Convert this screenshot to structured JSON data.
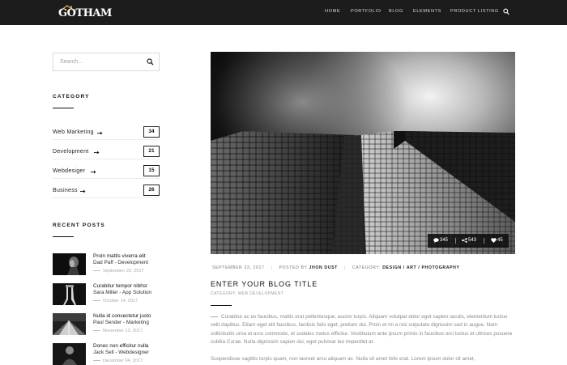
{
  "header": {
    "logo_text": "GOTHAM",
    "nav": [
      {
        "label": "HOME"
      },
      {
        "label": "PORTFOLIO"
      },
      {
        "label": "BLOG"
      },
      {
        "label": "ELEMENTS"
      },
      {
        "label": "PRODUCT LISTING"
      }
    ],
    "search_icon": "search-icon"
  },
  "sidebar": {
    "search_placeholder": "Search...",
    "category_heading": "CATEGORY",
    "categories": [
      {
        "label": "Web Marketing",
        "count": "34"
      },
      {
        "label": "Development",
        "count": "21"
      },
      {
        "label": "Webdesiger",
        "count": "15"
      },
      {
        "label": "Business",
        "count": "26"
      }
    ],
    "recent_heading": "RECENT POSTS",
    "recent_posts": [
      {
        "title": "Proin mattis viverra elit",
        "meta": "Dad Paff - Development",
        "date": "September 29, 2017"
      },
      {
        "title": "Curabitur tempor nibhsr",
        "meta": "Sara Miller - App Solution",
        "date": "October 14, 2017"
      },
      {
        "title": "Nulla id consectetur justo",
        "meta": "Paul Sender - Marketing",
        "date": "November 13, 2017"
      },
      {
        "title": "Donec non efficitur nulla",
        "meta": "Jack Sell - Webdesigner",
        "date": "December 04, 2017"
      }
    ]
  },
  "post": {
    "stats": {
      "comments": "345",
      "shares": "543",
      "likes": "45"
    },
    "date": "SEPTEMBER 23, 2017",
    "posted_by_label": "POSTED BY",
    "author": "JHON DUST",
    "category_label": "CATEGORY:",
    "categories": [
      "DESIGN",
      "ART",
      "PHOTOGRAPHY"
    ],
    "cat_divider": "/",
    "title": "ENTER YOUR BLOG TITLE",
    "subcategory": "CATEGORY, WEB DEVELOPMENT",
    "paragraph1": "Curabitur ac ex faucibus, mattis erat pellentesque, auctor turpis. Aliquam volutpat dolor eget sapien iaculis, elementum luctus velit dapibus. Etiam eget elit faucibus, facilisis felis eget, pretium dui. Proin et mi a nisi vulputate dignissim sed in augue. Nam sollicitudin urna et arcu commodo, et sodales metus efficitur. Vestibulum ante ipsum primis in faucibus orci luctus et ultrices posuere cubilia Curae. Nulla dignissim sapien dui, eget pulvinar leo imperdiet at.",
    "paragraph2": "Suspendisse sagittis turpis quam, non laoreet arcu aliquam ac. Nulla sit amet felis erat. Lorem ipsum dolor sit amet,"
  },
  "colors": {
    "topbar": "#1c1c1c",
    "text_dark": "#111111",
    "text_muted": "#8a8a8a"
  }
}
